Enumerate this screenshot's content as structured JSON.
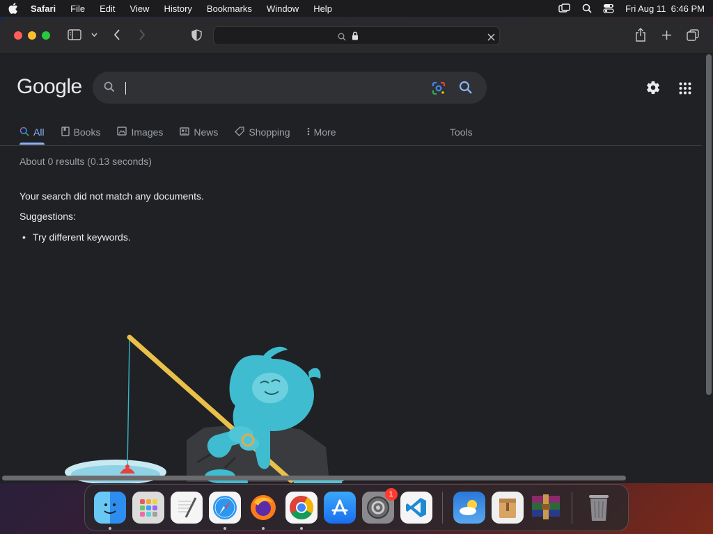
{
  "menubar": {
    "app_name": "Safari",
    "items": [
      "File",
      "Edit",
      "View",
      "History",
      "Bookmarks",
      "Window",
      "Help"
    ],
    "datetime": "Fri Aug 11  6:46 PM"
  },
  "browser": {
    "url": ""
  },
  "google": {
    "logo": "Google",
    "search_value": "",
    "tabs": [
      {
        "label": "All",
        "icon": "search-icon",
        "active": true
      },
      {
        "label": "Books",
        "icon": "book-icon"
      },
      {
        "label": "Images",
        "icon": "image-icon"
      },
      {
        "label": "News",
        "icon": "news-icon"
      },
      {
        "label": "Shopping",
        "icon": "tag-icon"
      },
      {
        "label": "More",
        "icon": "more-vertical-icon"
      }
    ],
    "tools_label": "Tools",
    "result_stats": "About 0 results (0.13 seconds)",
    "no_match": "Your search did not match any documents.",
    "suggestions_label": "Suggestions:",
    "suggestions": [
      "Try different keywords."
    ],
    "accent_color": "#8ab4f8"
  },
  "dock": {
    "apps": [
      {
        "name": "Finder",
        "running": true
      },
      {
        "name": "Launchpad"
      },
      {
        "name": "TextEdit"
      },
      {
        "name": "Safari",
        "running": true
      },
      {
        "name": "Firefox",
        "running": true
      },
      {
        "name": "Google Chrome",
        "running": true
      },
      {
        "name": "App Store"
      },
      {
        "name": "System Settings",
        "badge": "1"
      },
      {
        "name": "Visual Studio Code"
      },
      {
        "name": "Weather"
      },
      {
        "name": "Archive Utility"
      },
      {
        "name": "RAR Archiver"
      },
      {
        "name": "Trash"
      }
    ]
  }
}
